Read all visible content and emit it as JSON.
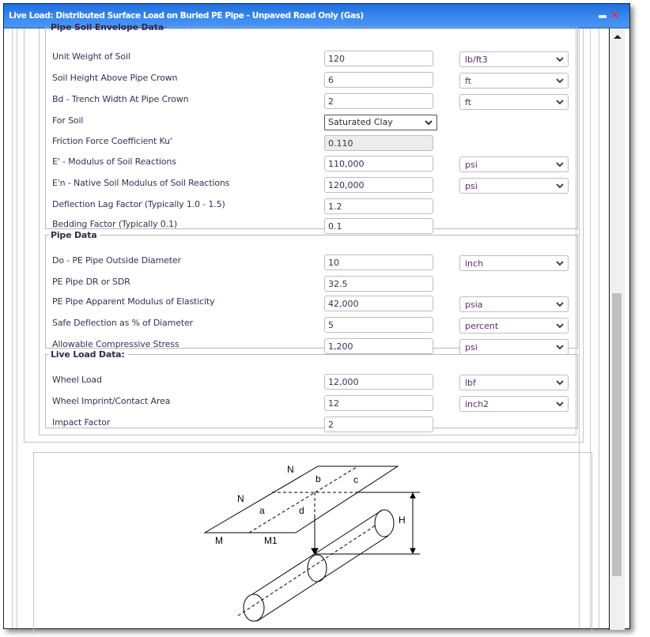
{
  "window": {
    "title": "Live Load: Distributed Surface Load on Buried PE Pipe - Unpaved Road Only (Gas)",
    "minimize_icon": "minimize-icon",
    "close_icon": "close-icon",
    "close_glyph": "×"
  },
  "groups": {
    "soil": {
      "legend": "Pipe Soil Envelope Data",
      "rows": [
        {
          "label": "Unit Weight of Soil",
          "value": "120",
          "unit": "lb/ft3"
        },
        {
          "label": "Soil Height Above Pipe Crown",
          "value": "6",
          "unit": "ft"
        },
        {
          "label": "Bd - Trench Width At Pipe Crown",
          "value": "2",
          "unit": "ft"
        },
        {
          "label": "For Soil",
          "value": "Saturated Clay"
        },
        {
          "label": "Friction Force Coefficient Ku'",
          "value": "0.110"
        },
        {
          "label": "E' - Modulus of Soil Reactions",
          "value": "110,000",
          "unit": "psi"
        },
        {
          "label": "E'n - Native Soil Modulus of Soil Reactions",
          "value": "120,000",
          "unit": "psi"
        },
        {
          "label": "Deflection Lag Factor (Typically 1.0 - 1.5)",
          "value": "1.2"
        },
        {
          "label": "Bedding Factor (Typically 0.1)",
          "value": "0.1"
        }
      ]
    },
    "pipe": {
      "legend": "Pipe Data",
      "rows": [
        {
          "label": "Do - PE Pipe Outside Diameter",
          "value": "10",
          "unit": "inch"
        },
        {
          "label": "PE Pipe DR or SDR",
          "value": "32.5"
        },
        {
          "label": "PE Pipe Apparent Modulus of Elasticity",
          "value": "42,000",
          "unit": "psia"
        },
        {
          "label": "Safe Deflection as % of Diameter",
          "value": "5",
          "unit": "percent"
        },
        {
          "label": "Allowable Compressive Stress",
          "value": "1,200",
          "unit": "psi"
        }
      ]
    },
    "live": {
      "legend": "Live Load Data:",
      "rows": [
        {
          "label": "Wheel Load",
          "value": "12,000",
          "unit": "lbf"
        },
        {
          "label": "Wheel Imprint/Contact Area",
          "value": "12",
          "unit": "inch2"
        },
        {
          "label": "Impact Factor",
          "value": "2"
        }
      ]
    }
  },
  "diagram": {
    "labels": {
      "N_top": "N",
      "N_left": "N",
      "a": "a",
      "b": "b",
      "c": "c",
      "d": "d",
      "M": "M",
      "M1": "M1",
      "H": "H"
    }
  },
  "scrollbar": {
    "position_fraction": 0.44,
    "visible_fraction": 0.47
  }
}
